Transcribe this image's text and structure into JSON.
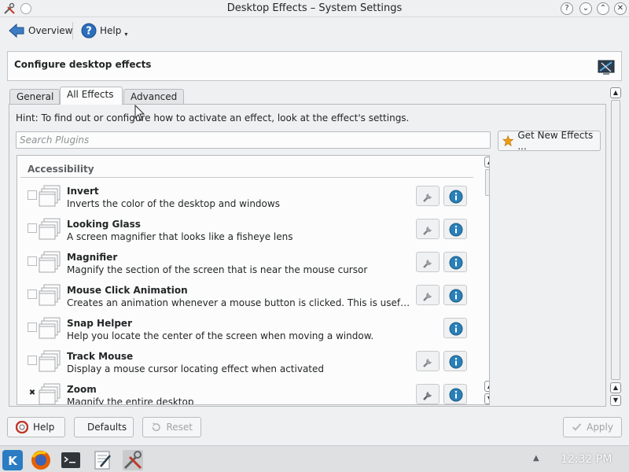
{
  "window": {
    "title": "Desktop Effects – System Settings",
    "title_buttons": [
      "?",
      "⌄",
      "⌃",
      "✕"
    ]
  },
  "toolbar": {
    "overview_label": "Overview",
    "help_label": "Help"
  },
  "header": {
    "title": "Configure desktop effects"
  },
  "tabs": [
    {
      "label": "General",
      "active": false
    },
    {
      "label": "All Effects",
      "active": true
    },
    {
      "label": "Advanced",
      "active": false
    }
  ],
  "hint": "Hint: To find out or configure how to activate an effect, look at the effect's settings.",
  "search": {
    "placeholder": "Search Plugins"
  },
  "get_new_label": "Get New Effects ...",
  "category": "Accessibility",
  "effects": [
    {
      "name": "Invert",
      "description": "Inverts the color of the desktop and windows",
      "checked": false,
      "configurable": true
    },
    {
      "name": "Looking Glass",
      "description": "A screen magnifier that looks like a fisheye lens",
      "checked": false,
      "configurable": true
    },
    {
      "name": "Magnifier",
      "description": "Magnify the section of the screen that is near the mouse cursor",
      "checked": false,
      "configurable": true
    },
    {
      "name": "Mouse Click Animation",
      "description": "Creates an animation whenever a mouse button is clicked. This is useful for sc...",
      "checked": false,
      "configurable": true
    },
    {
      "name": "Snap Helper",
      "description": "Help you locate the center of the screen when moving a window.",
      "checked": false,
      "configurable": false
    },
    {
      "name": "Track Mouse",
      "description": "Display a mouse cursor locating effect when activated",
      "checked": false,
      "configurable": true
    },
    {
      "name": "Zoom",
      "description": "Magnify the entire desktop",
      "checked": true,
      "configurable": true
    }
  ],
  "buttons": {
    "help": "Help",
    "defaults": "Defaults",
    "reset": "Reset",
    "apply": "Apply"
  },
  "taskbar": {
    "clock": "12:32 PM"
  },
  "colors": {
    "accent": "#3daee9",
    "background": "#eff0f1",
    "info_blue": "#2980b9"
  }
}
